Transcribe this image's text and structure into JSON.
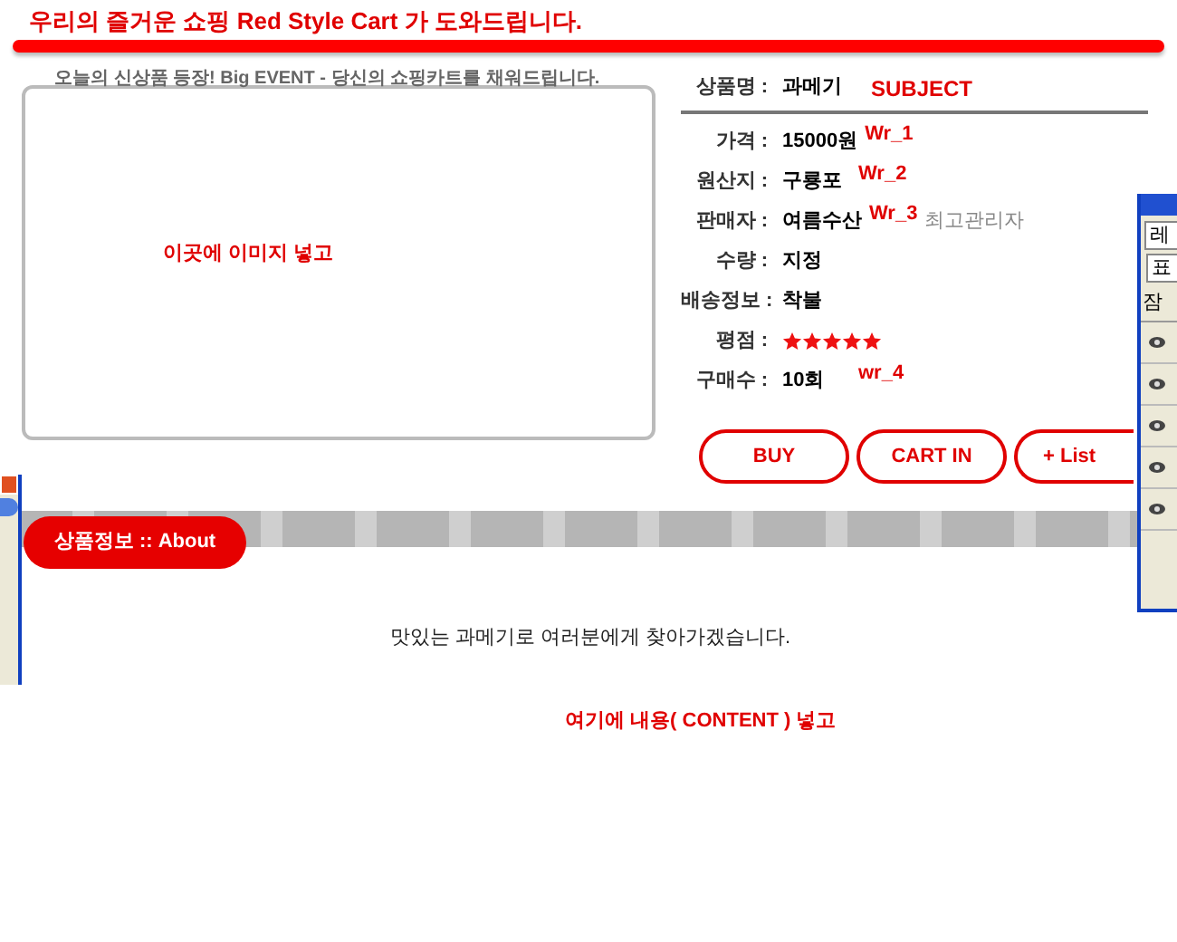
{
  "header": {
    "title": "우리의 즐거운 쇼핑 Red Style Cart 가 도와드립니다.",
    "subtitle": "오늘의 신상품 등장! Big EVENT - 당신의 쇼핑카트를 채워드립니다."
  },
  "image_area": {
    "text": "이곳에 이미지 넣고"
  },
  "product": {
    "name_label": "상품명 :",
    "name": "과메기",
    "name_tag": "SUBJECT",
    "fields": [
      {
        "kind": "text",
        "label": "가격 :",
        "value": "15000원",
        "tag": "Wr_1"
      },
      {
        "kind": "text",
        "label": "원산지 :",
        "value": "구룡포",
        "tag": "Wr_2"
      },
      {
        "kind": "text",
        "label": "판매자 :",
        "value": "여름수산",
        "extra": "최고관리자",
        "tag": "Wr_3"
      },
      {
        "kind": "text",
        "label": "수량 :",
        "value": "지정"
      },
      {
        "kind": "text",
        "label": "배송정보 :",
        "value": "착불"
      },
      {
        "kind": "stars",
        "label": "평점 :",
        "stars": 5
      },
      {
        "kind": "text",
        "label": "구매수 :",
        "value": "10회",
        "tag": "wr_4"
      }
    ]
  },
  "buttons": [
    "BUY",
    "CART IN",
    "+ List"
  ],
  "about_tab": {
    "label": "상품정보 :: About"
  },
  "content": {
    "text": "맛있는 과메기로 여러분에게 찾아가겠습니다.",
    "note": "여기에 내용( CONTENT ) 넣고"
  },
  "right_panel": {
    "tab": "레",
    "field": "표",
    "label": "잠"
  }
}
